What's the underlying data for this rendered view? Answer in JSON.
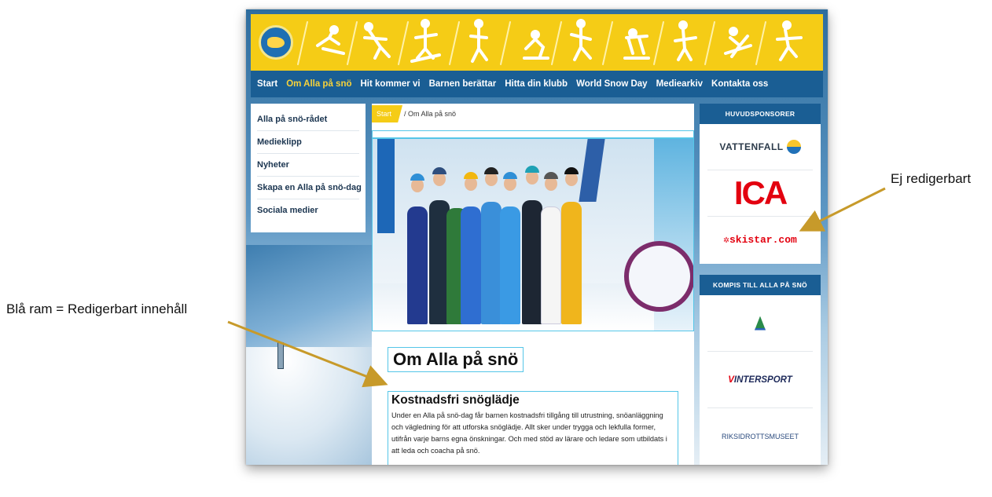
{
  "annotations": {
    "left_label": "Blå ram = Redigerbart innehåll",
    "right_label": "Ej redigerbart"
  },
  "nav": {
    "items": [
      "Start",
      "Om Alla på snö",
      "Hit kommer vi",
      "Barnen berättar",
      "Hitta din klubb",
      "World Snow Day",
      "Mediearkiv",
      "Kontakta oss"
    ],
    "active_index": 1
  },
  "left_menu": {
    "items": [
      "Alla på snö-rådet",
      "Medieklipp",
      "Nyheter",
      "Skapa en Alla på snö-dag",
      "Sociala medier"
    ]
  },
  "breadcrumb": {
    "start": "Start",
    "current": "/ Om Alla på snö"
  },
  "main": {
    "title": "Om Alla på snö",
    "section_title": "Kostnadsfri snöglädje",
    "body": "Under en Alla på snö-dag får barnen kostnadsfri tillgång till utrustning, snöanläggning och vägledning för att utforska snöglädje. Allt sker under trygga och lekfulla former, utifrån varje barns egna önskningar. Och med stöd av lärare och ledare som utbildats i att leda och coacha på snö."
  },
  "sidebar": {
    "main_sponsors_heading": "HUVUDSPONSORER",
    "main_sponsors": [
      "VATTENFALL",
      "ICA",
      "skistar.com"
    ],
    "partners_heading": "KOMPIS TILL ALLA PÅ SNÖ",
    "partners": [
      "INTERSPORT",
      "RIKSIDROTTSMUSEET"
    ]
  },
  "colors": {
    "banner_yellow": "#f5cc16",
    "nav_blue": "#1a5e94",
    "editable_frame": "#55c6e8",
    "arrow": "#c79a2a"
  },
  "icons": [
    "club-logo-icon",
    "skier-figures"
  ]
}
